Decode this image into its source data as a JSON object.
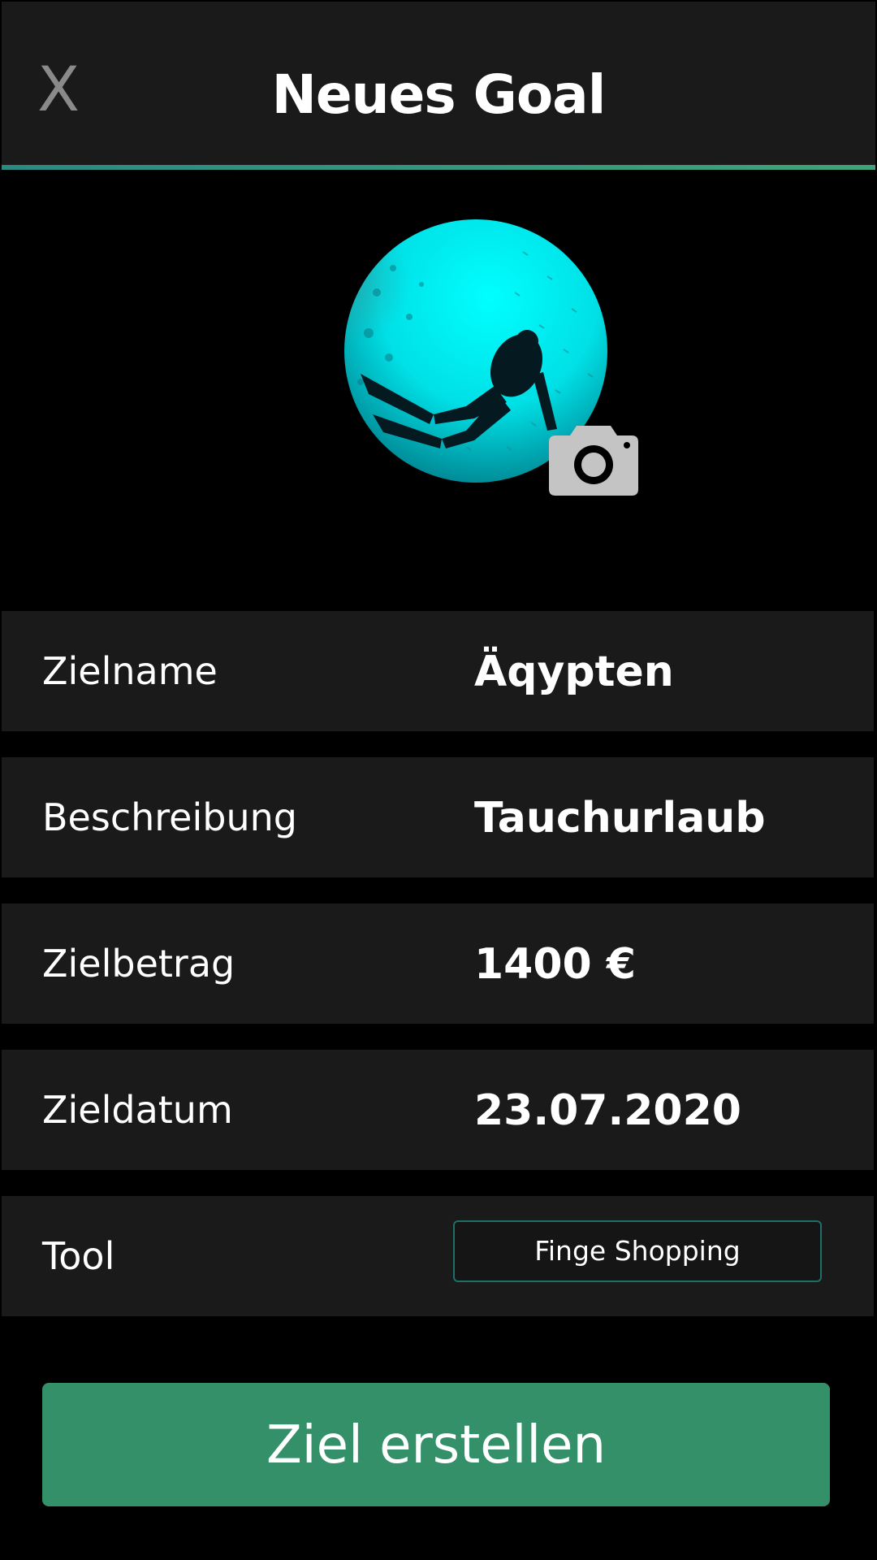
{
  "header": {
    "close_label": "X",
    "title": "Neues Goal"
  },
  "photo": {
    "image": "diver-underwater-photo",
    "camera_icon": "camera-icon"
  },
  "form": {
    "fields": [
      {
        "label": "Zielname",
        "value": "Äqypten"
      },
      {
        "label": "Beschreibung",
        "value": "Tauchurlaub"
      },
      {
        "label": "Zielbetrag",
        "value": "1400 €"
      },
      {
        "label": "Zieldatum",
        "value": "23.07.2020"
      }
    ],
    "tool": {
      "label": "Tool",
      "value": "Finge Shopping"
    }
  },
  "submit": {
    "label": "Ziel erstellen"
  },
  "colors": {
    "background": "#000000",
    "panel": "#1a1a1a",
    "accent": "#349068",
    "tool_border": "#1f6f68",
    "photo_water": "#00e5e5",
    "camera": "#c4c4c4"
  }
}
